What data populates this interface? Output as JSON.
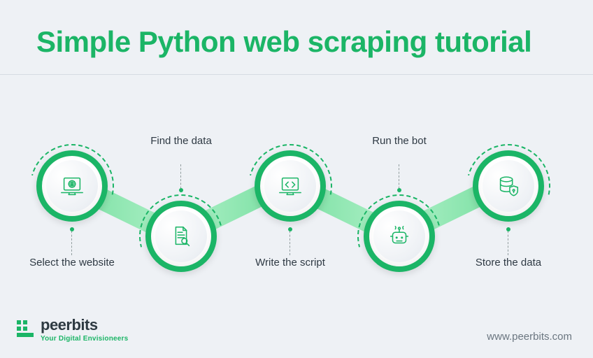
{
  "title": "Simple Python web scraping  tutorial",
  "steps": [
    {
      "label": "Select the website",
      "icon": "laptop-globe-icon"
    },
    {
      "label": "Find the data",
      "icon": "document-search-icon"
    },
    {
      "label": "Write the script",
      "icon": "laptop-code-icon"
    },
    {
      "label": "Run the bot",
      "icon": "robot-icon"
    },
    {
      "label": "Store the data",
      "icon": "database-shield-icon"
    }
  ],
  "brand": {
    "name": "peerbits",
    "tagline": "Your Digital Envisioneers"
  },
  "url": "www.peerbits.com"
}
